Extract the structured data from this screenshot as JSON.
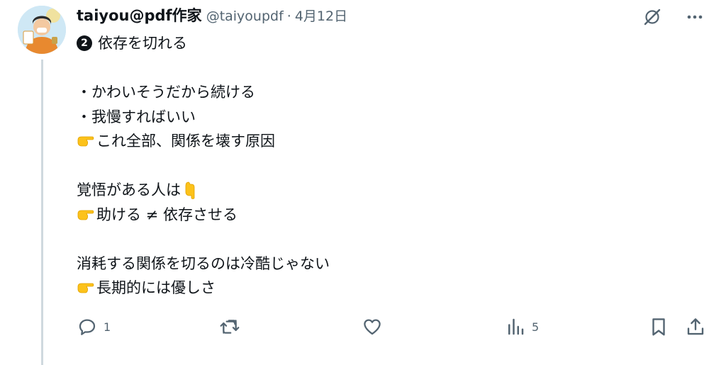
{
  "post": {
    "display_name": "taiyou@pdf作家",
    "handle": "@taiyoupdf",
    "separator": "·",
    "date": "4月12日",
    "badge_number": "2",
    "heading": "依存を切れる",
    "lines": [
      "・かわいそうだから続ける",
      "・我慢すればいい",
      "これ全部、関係を壊す原因",
      "覚悟がある人は",
      "助ける ≠ 依存させる",
      "消耗する関係を切るのは冷酷じゃない",
      "長期的には優しさ"
    ]
  },
  "actions": {
    "reply_count": "1",
    "retweet_count": "",
    "like_count": "",
    "views_count": "5"
  },
  "icons": {
    "grok": "grok-icon",
    "more": "more-icon",
    "pointing_right": "backhand-index-pointing-right-emoji",
    "pointing_down": "backhand-index-pointing-down-emoji"
  },
  "colors": {
    "text": "#0f1419",
    "secondary": "#536471",
    "thread_line": "#cfd9de"
  }
}
